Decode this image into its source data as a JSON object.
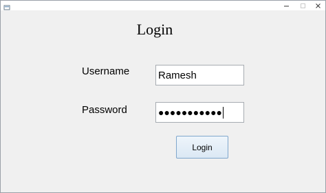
{
  "window": {
    "controls": {
      "minimize": "—",
      "maximize": "☐",
      "close": "✕"
    }
  },
  "form": {
    "title": "Login",
    "username_label": "Username",
    "username_value": "Ramesh",
    "password_label": "Password",
    "password_mask": "●●●●●●●●●●●",
    "login_button": "Login"
  },
  "colors": {
    "background": "#f0f0f0",
    "field_border": "#a6abb1",
    "button_border": "#7fa6cc"
  }
}
